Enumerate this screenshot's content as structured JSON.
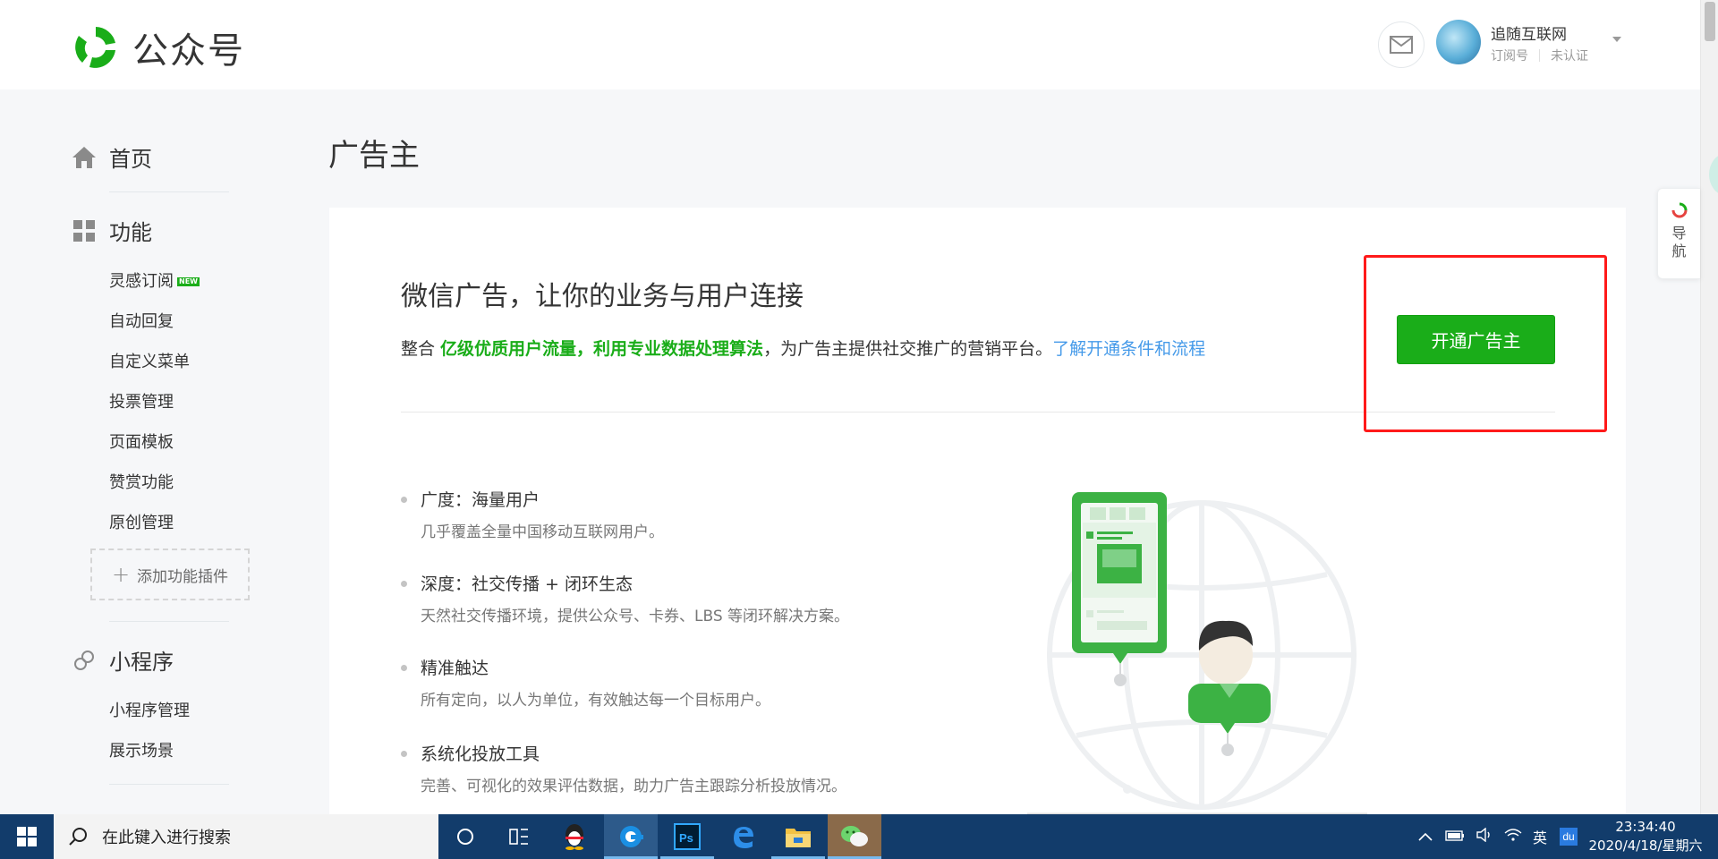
{
  "header": {
    "logo_text": "公众号",
    "account_name": "追随互联网",
    "account_type": "订阅号",
    "account_status": "未认证"
  },
  "sidebar": {
    "home": "首页",
    "features_head": "功能",
    "features": [
      {
        "label": "灵感订阅",
        "badge": "NEW"
      },
      {
        "label": "自动回复"
      },
      {
        "label": "自定义菜单"
      },
      {
        "label": "投票管理"
      },
      {
        "label": "页面模板"
      },
      {
        "label": "赞赏功能"
      },
      {
        "label": "原创管理"
      }
    ],
    "add_plugin": "添加功能插件",
    "miniprogram_head": "小程序",
    "miniprogram_items": [
      "小程序管理",
      "展示场景"
    ]
  },
  "main": {
    "page_title": "广告主",
    "promo_title": "微信广告，让你的业务与用户连接",
    "desc_prefix": "整合 ",
    "desc_highlight": "亿级优质用户流量，利用专业数据处理算法",
    "desc_middle": "，为广告主提供社交推广的营销平台。",
    "desc_link": "了解开通条件和流程",
    "open_button": "开通广告主",
    "features": [
      {
        "title": "广度：海量用户",
        "desc": "几乎覆盖全量中国移动互联网用户。"
      },
      {
        "title": "深度：社交传播 + 闭环生态",
        "desc": "天然社交传播环境，提供公众号、卡券、LBS 等闭环解决方案。"
      },
      {
        "title": "精准触达",
        "desc": "所有定向，以人为单位，有效触达每一个目标用户。"
      },
      {
        "title": "系统化投放工具",
        "desc": "完善、可视化的效果评估数据，助力广告主跟踪分析投放情况。"
      }
    ]
  },
  "float_nav": {
    "label": "导航"
  },
  "taskbar": {
    "search_placeholder": "在此键入进行搜索",
    "ime": "英",
    "time": "23:34:40",
    "date": "2020/4/18/星期六"
  },
  "colors": {
    "brand_green": "#1aad19",
    "link_blue": "#459ae9",
    "highlight_red": "#ff1a1a",
    "taskbar": "#123c6b"
  }
}
